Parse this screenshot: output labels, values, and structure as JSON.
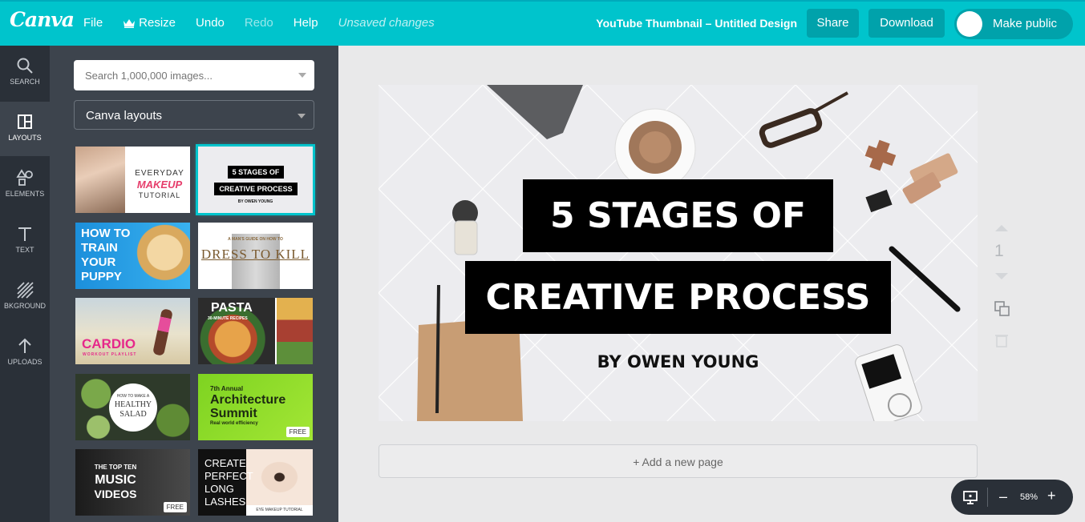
{
  "app": {
    "logo": "Canva"
  },
  "menu": {
    "file": "File",
    "resize": "Resize",
    "undo": "Undo",
    "redo": "Redo",
    "help": "Help",
    "status": "Unsaved changes"
  },
  "document": {
    "title": "YouTube Thumbnail – Untitled Design"
  },
  "actions": {
    "share": "Share",
    "download": "Download",
    "make_public": "Make public"
  },
  "rail": [
    {
      "label": "SEARCH",
      "icon": "search-icon"
    },
    {
      "label": "LAYOUTS",
      "icon": "layouts-icon"
    },
    {
      "label": "ELEMENTS",
      "icon": "elements-icon"
    },
    {
      "label": "TEXT",
      "icon": "text-icon"
    },
    {
      "label": "BKGROUND",
      "icon": "background-icon"
    },
    {
      "label": "UPLOADS",
      "icon": "upload-icon"
    }
  ],
  "panel": {
    "search_placeholder": "Search 1,000,000 images...",
    "layout_select": "Canva layouts",
    "templates": [
      {
        "lines": [
          "EVERYDAY",
          "MAKEUP",
          "TUTORIAL"
        ]
      },
      {
        "lines": [
          "5 STAGES OF",
          "CREATIVE PROCESS",
          "BY OWEN YOUNG"
        ]
      },
      {
        "lines": [
          "HOW TO",
          "TRAIN",
          "YOUR",
          "PUPPY"
        ]
      },
      {
        "lines": [
          "A MAN'S GUIDE ON HOW TO",
          "DRESS TO KILL"
        ]
      },
      {
        "lines": [
          "CARDIO",
          "WORKOUT PLAYLIST"
        ]
      },
      {
        "lines": [
          "PASTA",
          "30-MINUTE RECIPES"
        ]
      },
      {
        "lines": [
          "HOW TO MAKE A",
          "HEALTHY",
          "SALAD"
        ]
      },
      {
        "lines": [
          "7th Annual",
          "Architecture",
          "Summit",
          "Real world efficiency"
        ],
        "badge": "FREE"
      },
      {
        "lines": [
          "THE TOP TEN",
          "MUSIC",
          "VIDEOS"
        ],
        "badge": "FREE"
      },
      {
        "lines": [
          "CREATE",
          "PERFECT",
          "LONG",
          "LASHES",
          "EYE MAKEUP TUTORIAL"
        ]
      }
    ]
  },
  "canvas": {
    "title_line1": "5 STAGES OF",
    "title_line2": "CREATIVE PROCESS",
    "byline": "BY OWEN YOUNG",
    "page_number": "1",
    "add_page": "+ Add a new page"
  },
  "zoom": {
    "level": "58%",
    "minus": "–",
    "plus": "+"
  },
  "colors": {
    "brand": "#00c4cc",
    "brand_dark": "#00a2ab",
    "rail": "#2a3038",
    "panel": "#3d444d"
  }
}
